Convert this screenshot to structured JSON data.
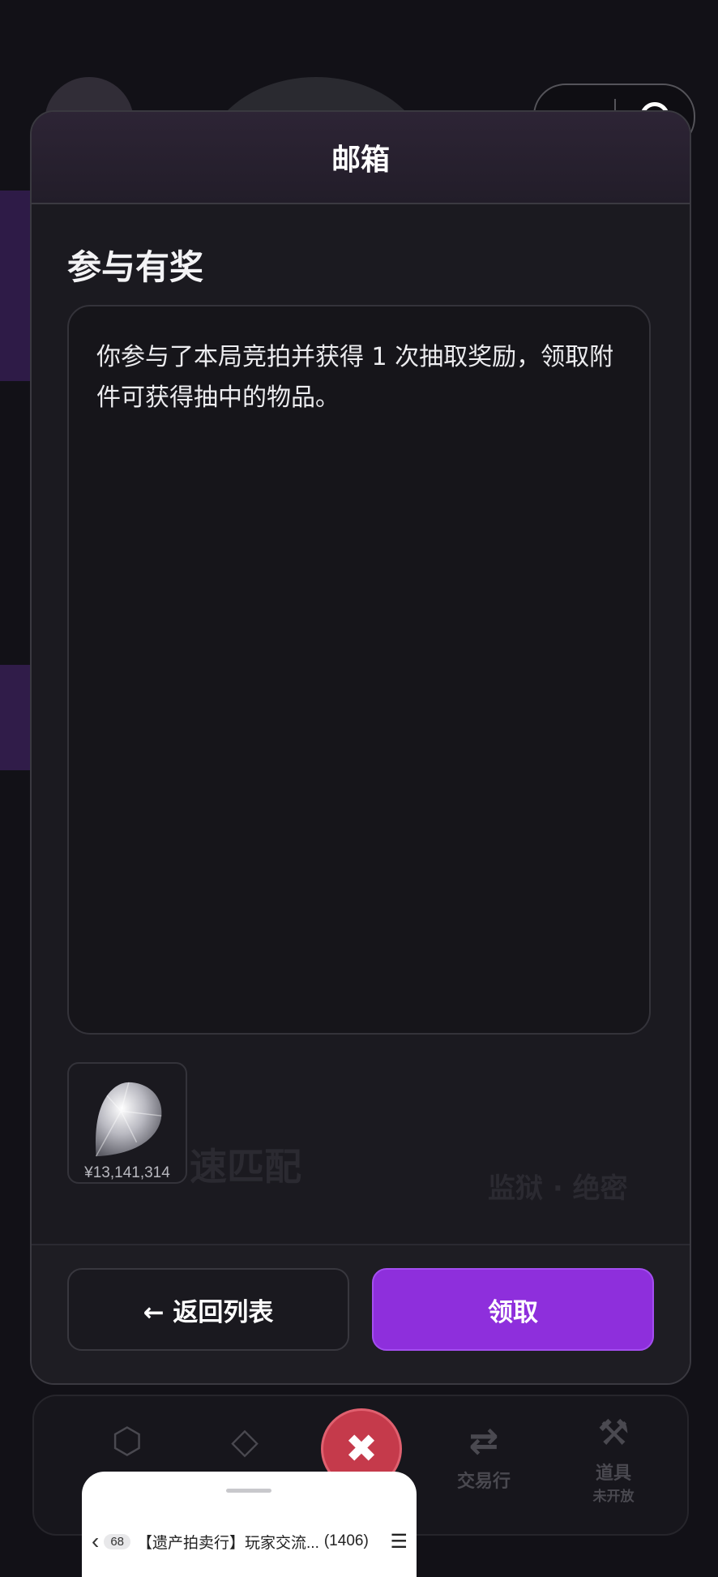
{
  "modal": {
    "title": "邮箱",
    "subject": "参与有奖",
    "body": "你参与了本局竞拍并获得 1 次抽取奖励，领取附件可获得抽中的物品。",
    "attachment": {
      "icon": "diamond-icon",
      "price": "¥13,141,314"
    },
    "buttons": {
      "back": "← 返回列表",
      "claim": "领取"
    }
  },
  "capsule": {
    "more_icon": "more-dots-icon",
    "close_icon": "target-circle-icon"
  },
  "background": {
    "tabs": [
      {
        "icon": "cube-icon",
        "label": ""
      },
      {
        "icon": "diamond-outline-icon",
        "label": ""
      },
      {
        "icon": "swap-icon",
        "label": "交易行"
      },
      {
        "icon": "tools-icon",
        "label": "道具",
        "sub": "未开放"
      }
    ],
    "close_fab_icon": "close-icon",
    "behind_text": {
      "left": "速匹配",
      "right": "监狱 · 绝密"
    }
  },
  "sheet": {
    "badge": "68",
    "title": "【遗产拍卖行】玩家交流...",
    "count": "(1406)"
  },
  "colors": {
    "accent": "#8e2fdc",
    "background": "#121117",
    "panel": "#1b1a20",
    "danger": "#c53a4b"
  }
}
